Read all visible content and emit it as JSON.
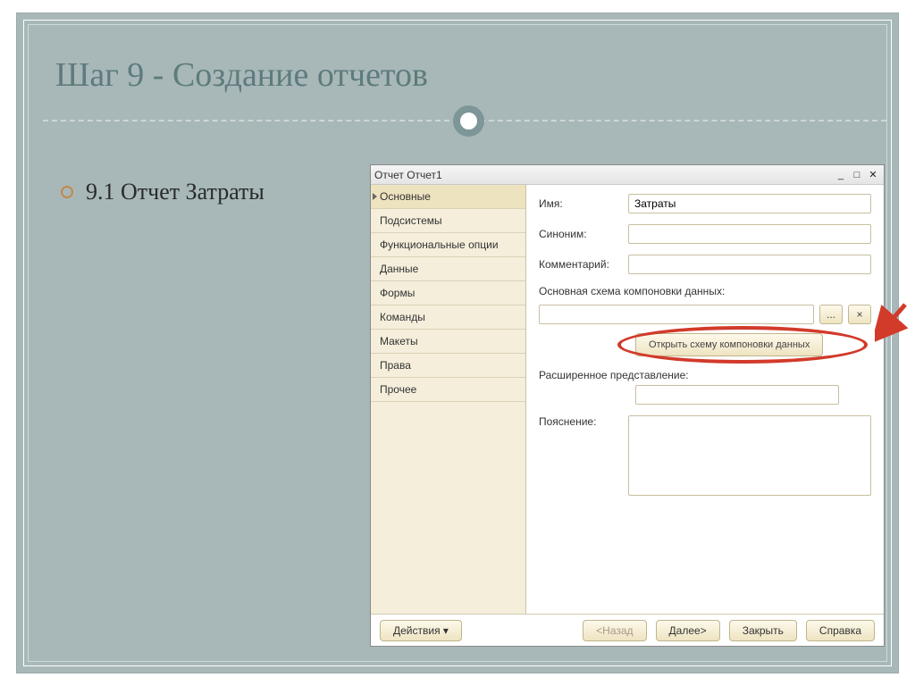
{
  "slide": {
    "title": "Шаг 9  -  Создание отчетов",
    "subtitle": "9.1  Отчет Затраты"
  },
  "window": {
    "title": "Отчет Отчет1",
    "sidebar": {
      "items": [
        {
          "label": "Основные",
          "active": true
        },
        {
          "label": "Подсистемы",
          "active": false
        },
        {
          "label": "Функциональные опции",
          "active": false
        },
        {
          "label": "Данные",
          "active": false
        },
        {
          "label": "Формы",
          "active": false
        },
        {
          "label": "Команды",
          "active": false
        },
        {
          "label": "Макеты",
          "active": false
        },
        {
          "label": "Права",
          "active": false
        },
        {
          "label": "Прочее",
          "active": false
        }
      ]
    },
    "form": {
      "name_label": "Имя:",
      "name_value": "Затраты",
      "synonym_label": "Синоним:",
      "synonym_value": "",
      "comment_label": "Комментарий:",
      "comment_value": "",
      "schema_section": "Основная схема компоновки данных:",
      "schema_value": "",
      "ellipsis": "...",
      "clear": "×",
      "open_schema": "Открыть схему компоновки данных",
      "extended_label": "Расширенное представление:",
      "extended_value": "",
      "explain_label": "Пояснение:",
      "explain_value": ""
    },
    "buttons": {
      "actions": "Действия",
      "back": "<Назад",
      "next": "Далее>",
      "close": "Закрыть",
      "help": "Справка"
    }
  }
}
